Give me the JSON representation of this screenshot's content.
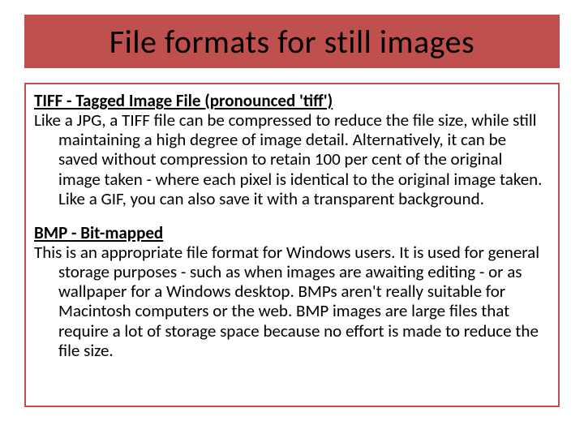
{
  "title": "File formats for still images",
  "sections": [
    {
      "heading": "TIFF - Tagged Image File (pronounced 'tiff')",
      "body": "Like a JPG, a TIFF file can be compressed to reduce the file size, while still maintaining a high degree of image detail. Alternatively, it can be saved without compression to retain 100 per cent of the original image taken - where each pixel is identical to the original image taken. Like a GIF, you can also save it with a transparent background."
    },
    {
      "heading": "BMP - Bit-mapped",
      "body": "This is an appropriate file format for Windows users. It is used for general storage purposes - such as when images are awaiting editing - or as wallpaper for a Windows desktop. BMPs aren't really suitable for Macintosh computers or the web. BMP images are large files that require a lot of storage space because no effort is made to reduce the file size."
    }
  ]
}
